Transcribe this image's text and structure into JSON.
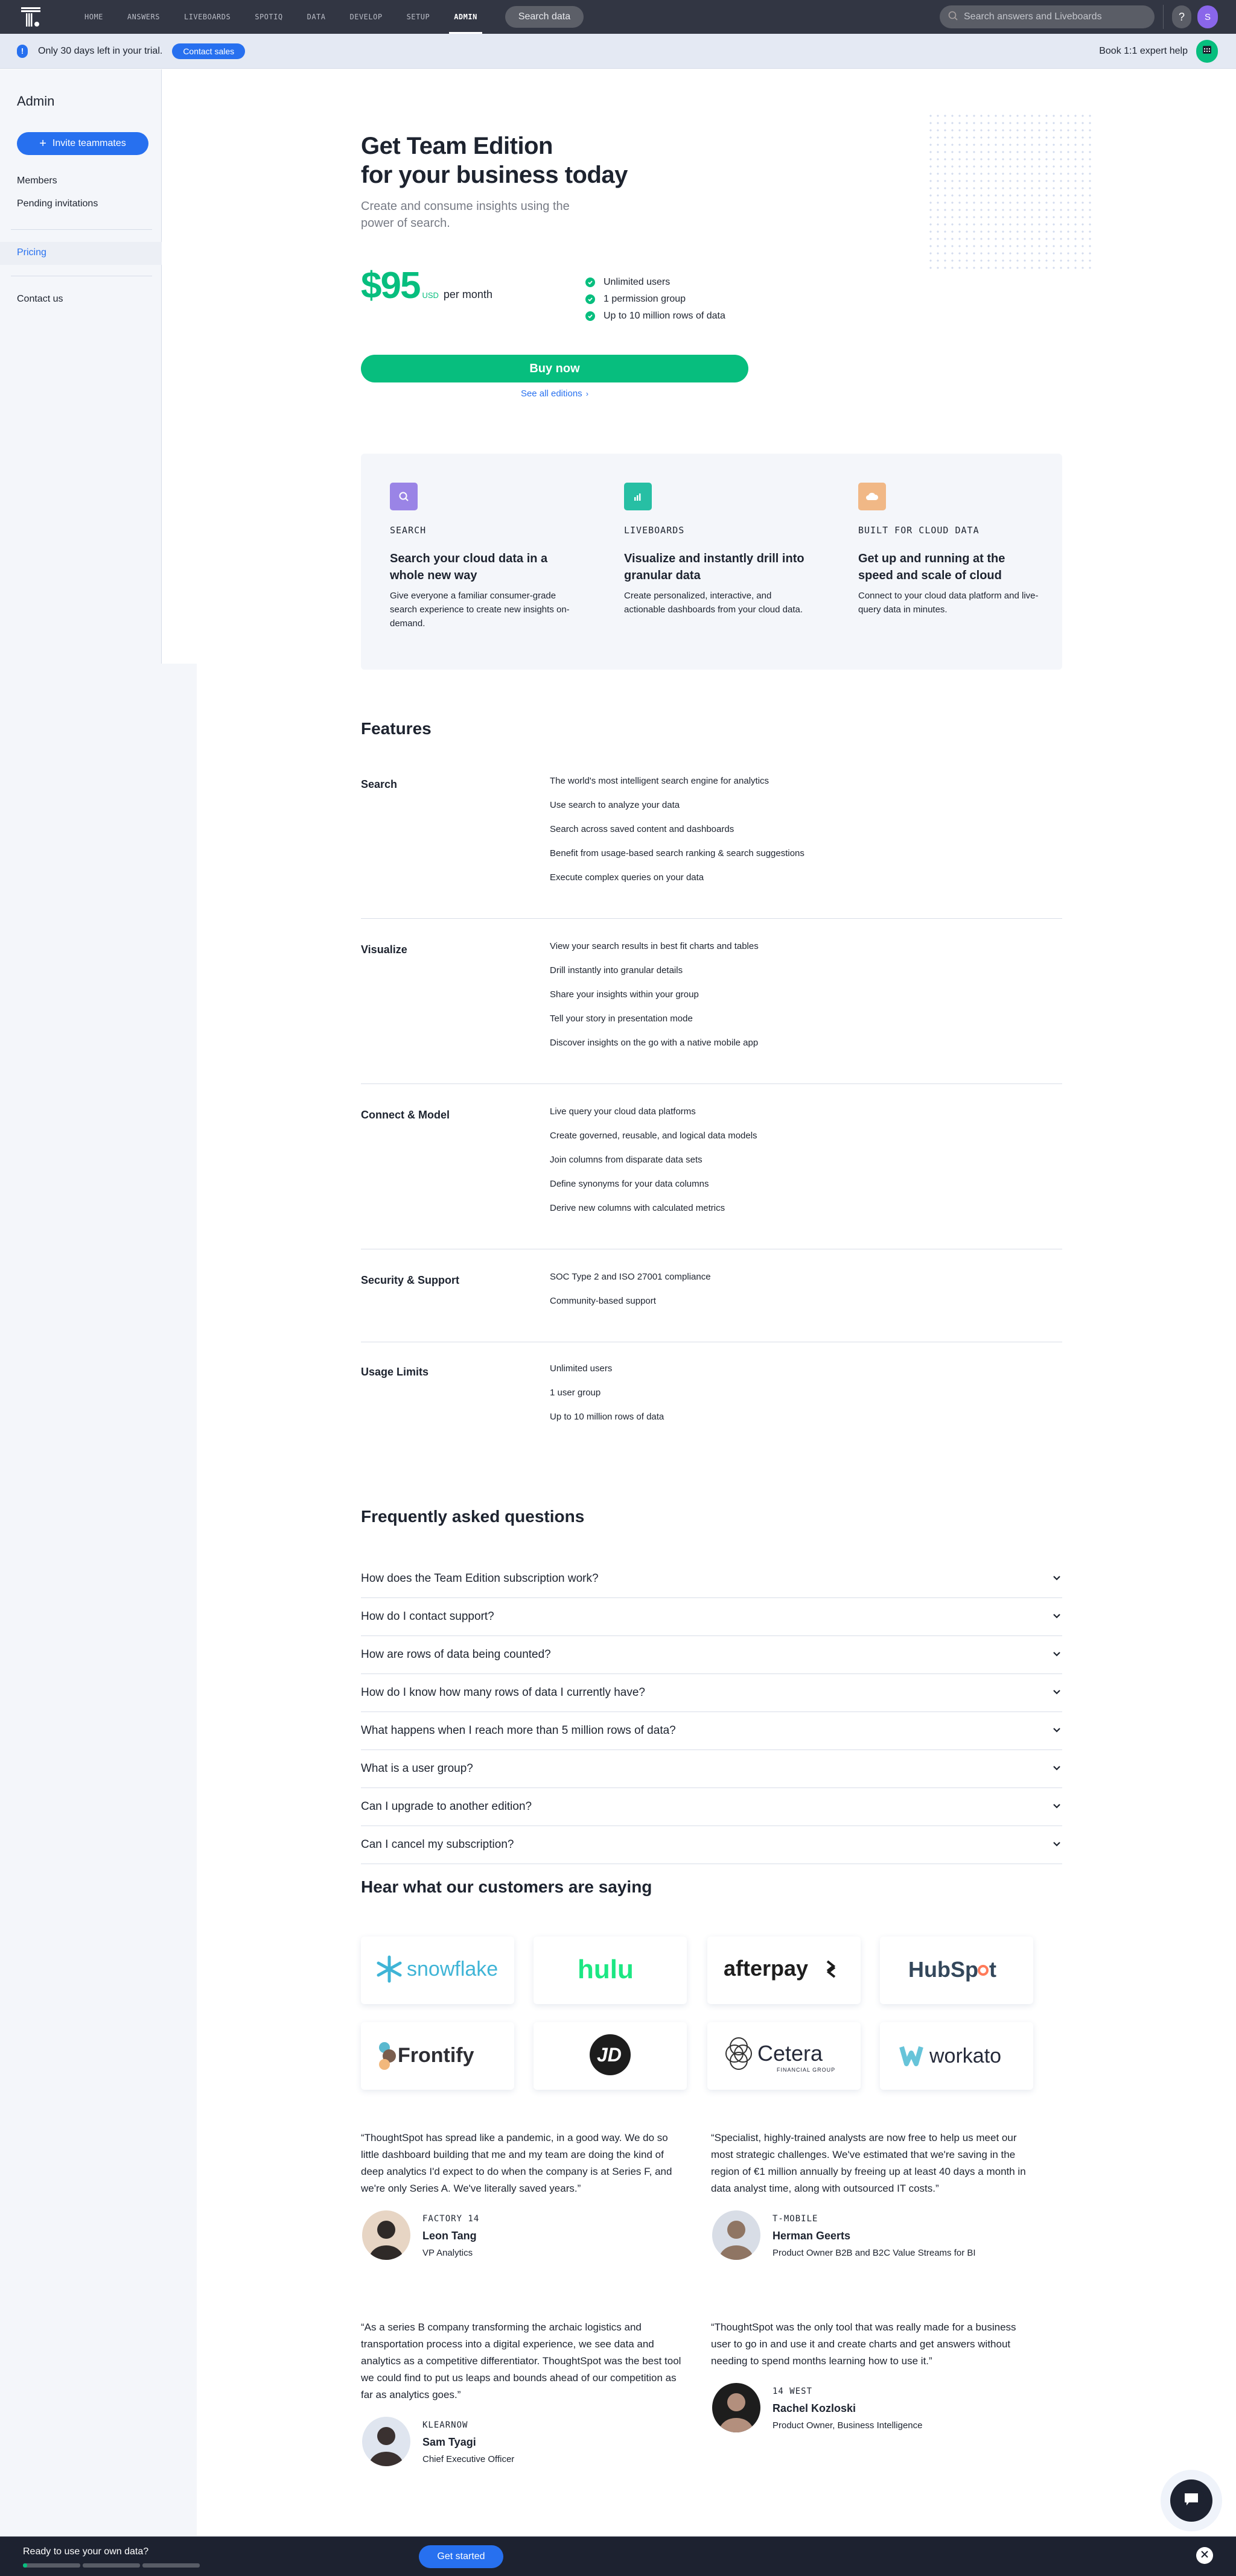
{
  "topnav": {
    "logo": "thoughtspot-logo",
    "items": [
      "HOME",
      "ANSWERS",
      "LIVEBOARDS",
      "SPOTIQ",
      "DATA",
      "DEVELOP",
      "SETUP",
      "ADMIN"
    ],
    "active": "ADMIN",
    "search_data_label": "Search data",
    "global_search_placeholder": "Search answers and Liveboards",
    "help_label": "?",
    "avatar_initial": "S",
    "avatar_color": "#8a66ea"
  },
  "banner": {
    "info_icon": "!",
    "trial_text": "Only 30 days left in your trial.",
    "contact_sales_label": "Contact sales",
    "expert_help_label": "Book 1:1 expert help"
  },
  "sidebar": {
    "title": "Admin",
    "invite_label": "Invite teammates",
    "items": [
      {
        "label": "Members",
        "active": false
      },
      {
        "label": "Pending invitations",
        "active": false
      },
      {
        "label": "Pricing",
        "active": true
      },
      {
        "label": "Contact us",
        "active": false
      }
    ]
  },
  "hero": {
    "title_line1": "Get Team Edition",
    "title_line2": "for your business today",
    "subtitle": "Create and consume insights using the power of search.",
    "price_amount": "$95",
    "price_currency": "USD",
    "price_period": "per month",
    "included": [
      "Unlimited users",
      "1 permission group",
      "Up to 10 million rows of data"
    ],
    "buy_label": "Buy now",
    "see_all_label": "See all editions",
    "accent_color": "#07be7e"
  },
  "benefits": [
    {
      "icon": "search-icon",
      "color": "#9a84e6",
      "kicker": "SEARCH",
      "title": "Search your cloud data in a whole new way",
      "desc": "Give everyone a familiar consumer-grade search experience to create new insights on-demand."
    },
    {
      "icon": "bar-chart-icon",
      "color": "#27bfa4",
      "kicker": "LIVEBOARDS",
      "title": "Visualize and instantly drill into granular data",
      "desc": "Create personalized, interactive, and actionable dashboards from your cloud data."
    },
    {
      "icon": "cloud-icon",
      "color": "#f1b886",
      "kicker": "BUILT FOR CLOUD DATA",
      "title": "Get up and running at the speed and scale of cloud",
      "desc": "Connect to your cloud data platform and live-query data in minutes."
    }
  ],
  "features": {
    "title": "Features",
    "groups": [
      {
        "name": "Search",
        "items": [
          "The world's most intelligent search engine for analytics",
          "Use search to analyze your data",
          "Search across saved content and dashboards",
          "Benefit from usage-based search ranking & search suggestions",
          "Execute complex queries on your data"
        ]
      },
      {
        "name": "Visualize",
        "items": [
          "View your search results in best fit charts and tables",
          "Drill instantly into granular details",
          "Share your insights within your group",
          "Tell your story in presentation mode",
          "Discover insights on the go with a native mobile app"
        ]
      },
      {
        "name": "Connect & Model",
        "items": [
          "Live query your cloud data platforms",
          "Create governed, reusable, and logical data models",
          "Join columns from disparate data sets",
          "Define synonyms for your data columns",
          "Derive new columns with calculated metrics"
        ]
      },
      {
        "name": "Security & Support",
        "items": [
          "SOC Type 2 and ISO 27001 compliance",
          "Community-based support"
        ]
      },
      {
        "name": "Usage Limits",
        "items": [
          "Unlimited users",
          "1 user group",
          "Up to 10 million rows of data"
        ]
      }
    ]
  },
  "faq": {
    "title": "Frequently asked questions",
    "questions": [
      "How does the Team Edition subscription work?",
      "How do I contact support?",
      "How are rows of data being counted?",
      "How do I know how many rows of data I currently have?",
      "What happens when I reach more than 5 million rows of data?",
      "What is a user group?",
      "Can I upgrade to another edition?",
      "Can I cancel my subscription?"
    ]
  },
  "customers": {
    "title": "Hear what our customers are saying",
    "logos": [
      "snowflake",
      "hulu",
      "afterpay",
      "HubSpot",
      "Frontify",
      "JD",
      "Cetera",
      "workato"
    ],
    "logo_sublabels": {
      "Cetera": "FINANCIAL GROUP"
    },
    "testimonials": [
      {
        "quote": "“ThoughtSpot has spread like a pandemic, in a good way. We do so little dashboard building that me and my team are doing the kind of deep analytics I'd expect to do when the company is at Series F, and we're only Series A. We've literally saved years.”",
        "company": "FACTORY 14",
        "name": "Leon Tang",
        "role": "VP Analytics"
      },
      {
        "quote": "“Specialist, highly-trained analysts are now free to help us meet our most strategic challenges. We've estimated that we're saving in the region of €1 million annually by freeing up at least 40 days a month in data analyst time, along with outsourced IT costs.”",
        "company": "T-MOBILE",
        "name": "Herman Geerts",
        "role": "Product Owner B2B and B2C Value Streams for BI"
      },
      {
        "quote": "“As a series B company transforming the archaic logistics and transportation process into a digital experience, we see data and analytics as a competitive differentiator. ThoughtSpot was the best tool we could find to put us leaps and bounds ahead of our competition as far as analytics goes.”",
        "company": "KLEARNOW",
        "name": "Sam Tyagi",
        "role": "Chief Executive Officer"
      },
      {
        "quote": "“ThoughtSpot was the only tool that was really made for a business user to go in and use it and create charts and get answers without needing to spend months learning how to use it.”",
        "company": "14 WEST",
        "name": "Rachel Kozloski",
        "role": "Product Owner, Business Intelligence"
      }
    ]
  },
  "bottombar": {
    "text": "Ready to use your own data?",
    "progress_segments": 3,
    "progress_fill_first_segment": 0.07,
    "get_started_label": "Get started"
  }
}
